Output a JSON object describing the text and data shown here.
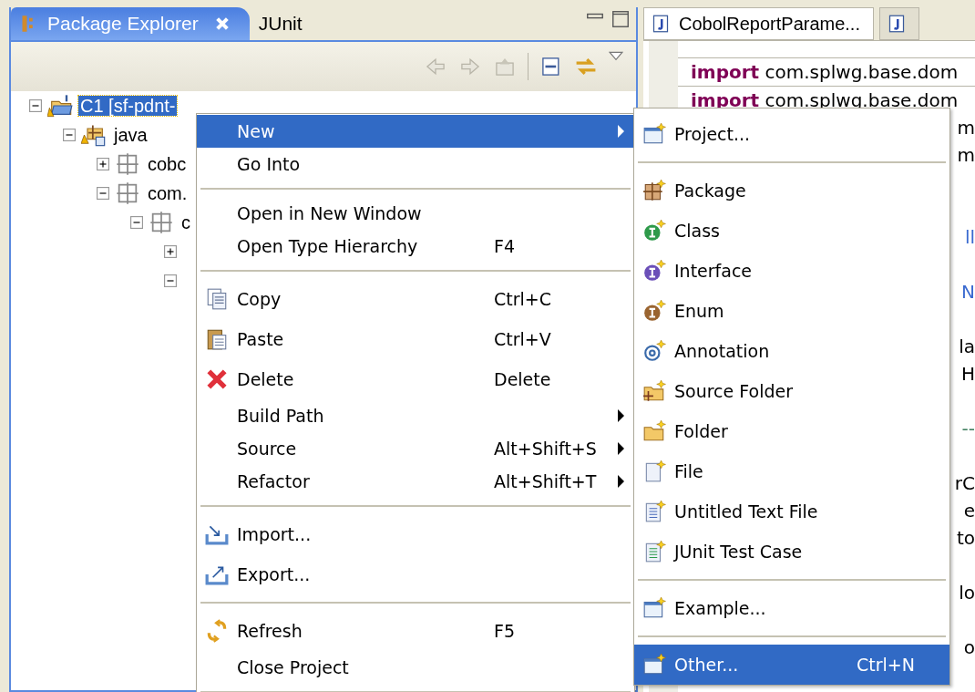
{
  "explorer": {
    "tabs": [
      {
        "label": "Package Explorer",
        "selected": true
      },
      {
        "label": "JUnit",
        "selected": false
      }
    ],
    "tree": [
      {
        "label": "C1 [sf-pdnt-",
        "kind": "project",
        "expanded": true,
        "selected": true,
        "children": [
          {
            "label": "java",
            "kind": "source",
            "expanded": true,
            "selected": false,
            "children": [
              {
                "label": "cobc",
                "kind": "package",
                "expanded": false,
                "selected": false
              },
              {
                "label": "com.",
                "kind": "package",
                "expanded": true,
                "selected": false,
                "children": [
                  {
                    "label": "c",
                    "kind": "package",
                    "expanded": true,
                    "selected": false,
                    "children": [
                      {
                        "expanded": false
                      },
                      {
                        "expanded": true
                      }
                    ]
                  }
                ]
              }
            ]
          }
        ]
      }
    ]
  },
  "editor": {
    "tabs": [
      {
        "label": "CobolReportParame...",
        "selected": true
      },
      {
        "selected": false
      }
    ],
    "lines": [
      {
        "kind": "code",
        "keyword": "import",
        "text": "com.splwg.base.dom"
      },
      {
        "kind": "code",
        "keyword": "import",
        "text": "com.splwg.base.dom"
      },
      {
        "kind": "fragment",
        "text": "m"
      },
      {
        "kind": "fragment",
        "text": "m"
      },
      {
        "kind": "blank"
      },
      {
        "kind": "blank"
      },
      {
        "kind": "link",
        "text": "ll"
      },
      {
        "kind": "blank"
      },
      {
        "kind": "link",
        "text": "N"
      },
      {
        "kind": "blank"
      },
      {
        "kind": "fragment",
        "text": "la"
      },
      {
        "kind": "fragment",
        "text": "H"
      },
      {
        "kind": "blank"
      },
      {
        "kind": "comment",
        "text": "--"
      },
      {
        "kind": "blank"
      },
      {
        "kind": "fragment",
        "text": "rC"
      },
      {
        "kind": "fragment",
        "text": "e"
      },
      {
        "kind": "fragment",
        "text": "to"
      },
      {
        "kind": "blank"
      },
      {
        "kind": "fragment",
        "text": "lo"
      },
      {
        "kind": "blank"
      },
      {
        "kind": "fragment",
        "text": "o"
      }
    ]
  },
  "context_menu": [
    {
      "kind": "item",
      "label": "New",
      "submenu": true,
      "selected": true
    },
    {
      "kind": "item",
      "label": "Go Into",
      "selected": false
    },
    {
      "kind": "separator"
    },
    {
      "kind": "item",
      "label": "Open in New Window",
      "selected": false
    },
    {
      "kind": "item",
      "label": "Open Type Hierarchy",
      "shortcut": "F4",
      "selected": false
    },
    {
      "kind": "separator"
    },
    {
      "kind": "item",
      "label": "Copy",
      "shortcut": "Ctrl+C",
      "selected": false
    },
    {
      "kind": "item",
      "label": "Paste",
      "shortcut": "Ctrl+V",
      "selected": false
    },
    {
      "kind": "item",
      "label": "Delete",
      "shortcut": "Delete",
      "selected": false
    },
    {
      "kind": "item",
      "label": "Build Path",
      "submenu": true,
      "selected": false
    },
    {
      "kind": "item",
      "label": "Source",
      "shortcut": "Alt+Shift+S",
      "submenu": true,
      "selected": false
    },
    {
      "kind": "item",
      "label": "Refactor",
      "shortcut": "Alt+Shift+T",
      "submenu": true,
      "selected": false
    },
    {
      "kind": "separator"
    },
    {
      "kind": "item",
      "label": "Import...",
      "selected": false
    },
    {
      "kind": "item",
      "label": "Export...",
      "selected": false
    },
    {
      "kind": "separator"
    },
    {
      "kind": "item",
      "label": "Refresh",
      "shortcut": "F5",
      "selected": false
    },
    {
      "kind": "item",
      "label": "Close Project",
      "selected": false
    },
    {
      "kind": "separator"
    }
  ],
  "new_submenu": [
    {
      "kind": "item",
      "label": "Project...",
      "selected": false
    },
    {
      "kind": "separator"
    },
    {
      "kind": "item",
      "label": "Package",
      "selected": false
    },
    {
      "kind": "item",
      "label": "Class",
      "selected": false
    },
    {
      "kind": "item",
      "label": "Interface",
      "selected": false
    },
    {
      "kind": "item",
      "label": "Enum",
      "selected": false
    },
    {
      "kind": "item",
      "label": "Annotation",
      "selected": false
    },
    {
      "kind": "item",
      "label": "Source Folder",
      "selected": false
    },
    {
      "kind": "item",
      "label": "Folder",
      "selected": false
    },
    {
      "kind": "item",
      "label": "File",
      "selected": false
    },
    {
      "kind": "item",
      "label": "Untitled Text File",
      "selected": false
    },
    {
      "kind": "item",
      "label": "JUnit Test Case",
      "selected": false
    },
    {
      "kind": "separator"
    },
    {
      "kind": "item",
      "label": "Example...",
      "selected": false
    },
    {
      "kind": "separator"
    },
    {
      "kind": "item",
      "label": "Other...",
      "shortcut": "Ctrl+N",
      "selected": true
    }
  ]
}
